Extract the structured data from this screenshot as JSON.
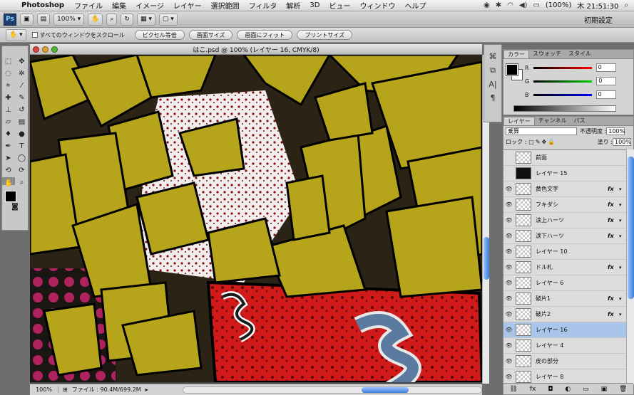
{
  "menubar": {
    "app": "Photoshop",
    "items": [
      "ファイル",
      "編集",
      "イメージ",
      "レイヤー",
      "選択範囲",
      "フィルタ",
      "解析",
      "3D",
      "ビュー",
      "ウィンドウ",
      "ヘルプ"
    ],
    "battery": "(100%)",
    "clock": "木 21:51:30"
  },
  "appbar": {
    "ps_logo": "Ps",
    "zoom": "100%",
    "workspace": "初期設定"
  },
  "options": {
    "scroll_all_label": "すべてのウィンドウをスクロール",
    "buttons": [
      "ピクセル等倍",
      "画面サイズ",
      "画面にフィット",
      "プリントサイズ"
    ]
  },
  "document": {
    "title": "はこ.psd @ 100% (レイヤー 16, CMYK/8)",
    "zoom": "100%",
    "file_info": "ファイル : 90.4M/699.2M"
  },
  "color_panel": {
    "tabs": [
      "カラー",
      "スウォッチ",
      "スタイル"
    ],
    "r_label": "R",
    "r_value": "0",
    "g_label": "G",
    "g_value": "0",
    "b_label": "B",
    "b_value": "0"
  },
  "layers_panel": {
    "tabs": [
      "レイヤー",
      "チャンネル",
      "パス"
    ],
    "blend_mode": "乗算",
    "opacity_label": "不透明度 :",
    "opacity_value": "100%",
    "lock_label": "ロック :",
    "fill_label": "塗り :",
    "fill_value": "100%",
    "layers": [
      {
        "name": "前面",
        "visible": false,
        "fx": false,
        "active": false
      },
      {
        "name": "レイヤー 15",
        "visible": false,
        "fx": false,
        "active": false
      },
      {
        "name": "黄色文字",
        "visible": true,
        "fx": true,
        "active": false
      },
      {
        "name": "フキダシ",
        "visible": true,
        "fx": true,
        "active": false
      },
      {
        "name": "涙上ハーツ",
        "visible": true,
        "fx": true,
        "active": false
      },
      {
        "name": "涙下ハーツ",
        "visible": true,
        "fx": true,
        "active": false
      },
      {
        "name": "レイヤー 10",
        "visible": true,
        "fx": false,
        "active": false
      },
      {
        "name": "ドル札",
        "visible": true,
        "fx": true,
        "active": false
      },
      {
        "name": "レイヤー 6",
        "visible": true,
        "fx": false,
        "active": false
      },
      {
        "name": "破片1",
        "visible": true,
        "fx": true,
        "active": false
      },
      {
        "name": "破片2",
        "visible": true,
        "fx": true,
        "active": false
      },
      {
        "name": "レイヤー 16",
        "visible": true,
        "fx": false,
        "active": true
      },
      {
        "name": "レイヤー 4",
        "visible": true,
        "fx": false,
        "active": false
      },
      {
        "name": "皮の部分",
        "visible": true,
        "fx": false,
        "active": false
      },
      {
        "name": "レイヤー 8",
        "visible": true,
        "fx": false,
        "active": false
      }
    ]
  },
  "colors": {
    "selection": "#a9c6ea",
    "scroll_thumb": "#3b7fd8"
  }
}
